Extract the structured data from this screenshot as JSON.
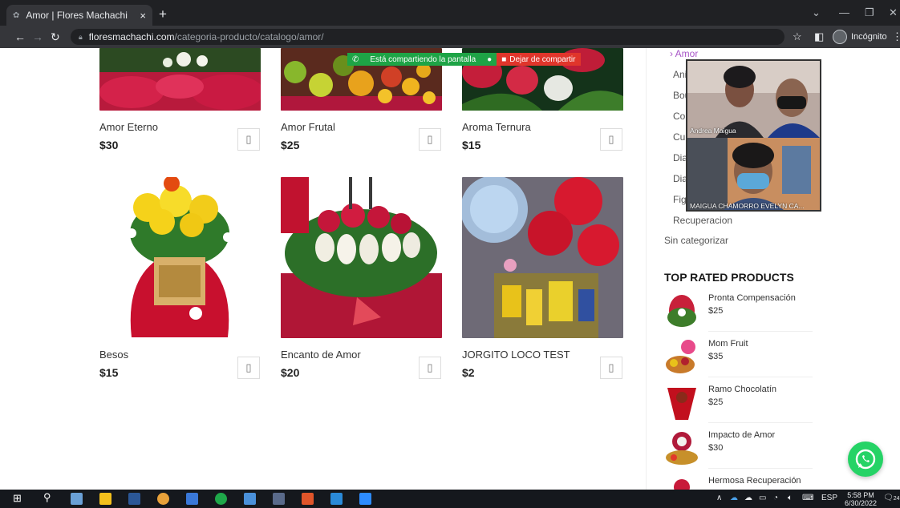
{
  "browser": {
    "tab_title": "Amor | Flores Machachi",
    "tab_close": "×",
    "new_tab": "+",
    "url_host": "floresmachachi.com",
    "url_path": "/categoria-producto/catalogo/amor/",
    "profile_label": "Incógnito"
  },
  "share_banner": {
    "sharing_text": "Está compartiendo la pantalla",
    "stop_text": "Dejar de compartir"
  },
  "products": [
    {
      "name": "Amor Eterno",
      "price": "$30"
    },
    {
      "name": "Amor Frutal",
      "price": "$25"
    },
    {
      "name": "Aroma Ternura",
      "price": "$15"
    },
    {
      "name": "Besos",
      "price": "$15"
    },
    {
      "name": "Encanto de Amor",
      "price": "$20"
    },
    {
      "name": "JORGITO LOCO TEST",
      "price": "$2"
    }
  ],
  "sidebar": {
    "active_category": "› Amor",
    "categories": [
      "Ani",
      "Bou",
      "Co",
      "Cu",
      "Dia",
      "Dia",
      "Fig",
      "Recuperacion"
    ],
    "uncategorized": "Sin categorizar",
    "top_rated_title": "TOP RATED PRODUCTS",
    "top_rated": [
      {
        "name": "Pronta Compensación",
        "price": "$25"
      },
      {
        "name": "Mom Fruit",
        "price": "$35"
      },
      {
        "name": "Ramo Chocolatín",
        "price": "$25"
      },
      {
        "name": "Impacto de Amor",
        "price": "$30"
      },
      {
        "name": "Hermosa Recuperación",
        "price": ""
      }
    ]
  },
  "video_call": {
    "participant_1": "Andrea Maigua",
    "participant_2": "MAIGUA CHAMORRO EVELYN CA..."
  },
  "taskbar": {
    "language": "ESP",
    "time": "5:58 PM",
    "date": "6/30/2022",
    "notif_count": "24"
  }
}
